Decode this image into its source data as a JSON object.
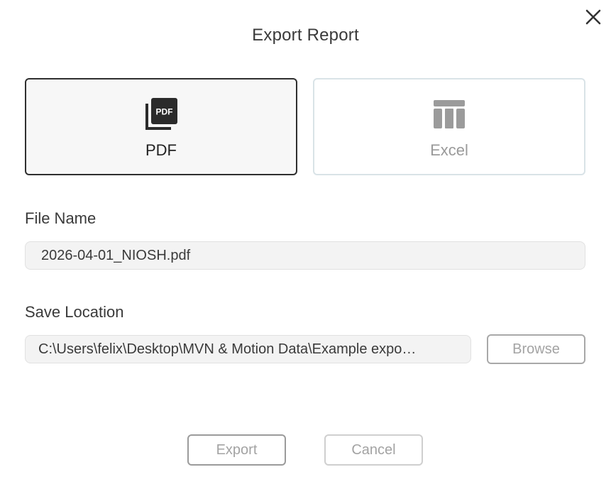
{
  "dialog": {
    "title": "Export Report",
    "close_icon": "close-icon"
  },
  "formats": {
    "pdf": {
      "label": "PDF",
      "icon": "pdf-file-icon",
      "selected": true
    },
    "excel": {
      "label": "Excel",
      "icon": "table-icon",
      "selected": false
    }
  },
  "file_name": {
    "label": "File Name",
    "value": "2026-04-01_NIOSH.pdf"
  },
  "save_location": {
    "label": "Save Location",
    "value": "C:\\Users\\felix\\Desktop\\MVN & Motion Data\\Example expo…",
    "browse_label": "Browse"
  },
  "actions": {
    "export_label": "Export",
    "cancel_label": "Cancel"
  },
  "colors": {
    "selected_border": "#2f2f2f",
    "unselected_border": "#d9e3e7",
    "disabled_text": "#a3a3a3"
  }
}
